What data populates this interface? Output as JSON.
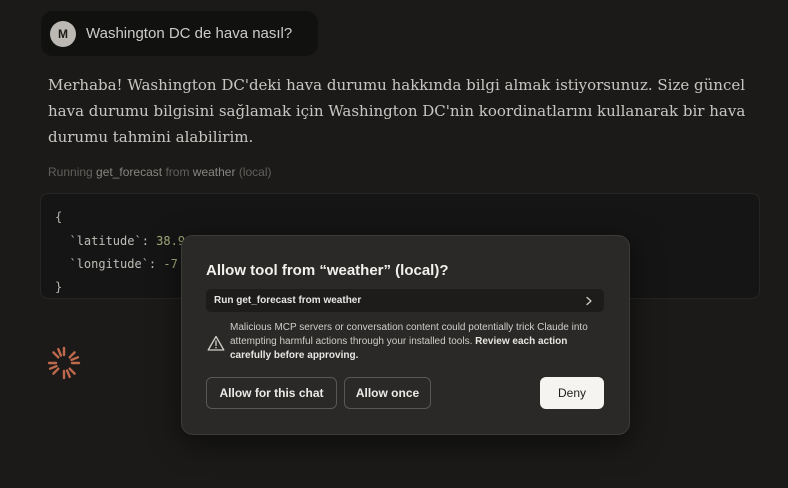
{
  "user_message": {
    "avatar_initial": "M",
    "text": "Washington DC de hava nasıl?"
  },
  "assistant": {
    "text": "Merhaba! Washington DC'deki hava durumu hakkında bilgi almak istiyorsunuz. Size güncel hava durumu bilgisini sağlamak için Washington DC'nin koordinatlarını kullanarak bir hava durumu tahmini alabilirim."
  },
  "tool_status": {
    "prefix": "Running",
    "tool_name": "get_forecast",
    "middle": "from",
    "server_name": "weather",
    "suffix": "(local)"
  },
  "code": {
    "open_brace": "{",
    "line1_key": "  `latitude`: ",
    "line1_value": "38.9",
    "line2_key": "  `longitude`: ",
    "line2_value": "-7",
    "close_brace": "}"
  },
  "modal": {
    "title": "Allow tool from “weather” (local)?",
    "tool_row_label": "Run get_forecast from weather",
    "warning_text": "Malicious MCP servers or conversation content could potentially trick Claude into attempting harmful actions through your installed tools.",
    "warning_bold": "Review each action carefully before approving.",
    "allow_chat_label": "Allow for this chat",
    "allow_once_label": "Allow once",
    "deny_label": "Deny"
  },
  "icons": {
    "spinner": "loading-spinner-icon",
    "warning": "warning-triangle-icon",
    "chevron": "chevron-right-icon"
  },
  "colors": {
    "background": "#1f1e1d",
    "modal_background": "#2a2927",
    "spinner_accent": "#d97757",
    "deny_button": "#f5f4f0"
  }
}
